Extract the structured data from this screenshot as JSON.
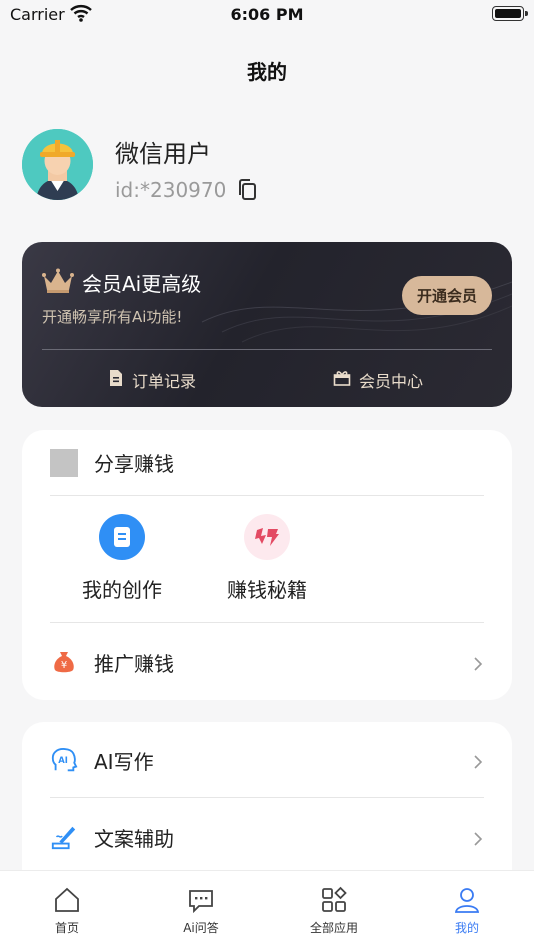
{
  "status_bar": {
    "carrier": "Carrier",
    "time": "6:06 PM"
  },
  "header": {
    "title": "我的"
  },
  "profile": {
    "name": "微信用户",
    "id": "id:*230970"
  },
  "member_card": {
    "title": "会员Ai更高级",
    "subtitle": "开通畅享所有Ai功能!",
    "button_label": "开通会员",
    "actions": [
      {
        "label": "订单记录",
        "icon": "document-icon"
      },
      {
        "label": "会员中心",
        "icon": "gift-box-icon"
      }
    ]
  },
  "share_section": {
    "title": "分享赚钱",
    "tools": [
      {
        "label": "我的创作",
        "icon": "document-icon",
        "color": "#2f8ff5"
      },
      {
        "label": "赚钱秘籍",
        "icon": "secret-book-icon",
        "color": "#e34a63"
      }
    ],
    "promote": {
      "label": "推广赚钱",
      "icon": "money-bag-icon"
    }
  },
  "ai_section": {
    "items": [
      {
        "label": "AI写作",
        "icon": "ai-head-icon"
      },
      {
        "label": "文案辅助",
        "icon": "pen-write-icon"
      }
    ]
  },
  "tab_bar": {
    "tabs": [
      {
        "label": "首页",
        "icon": "home-icon"
      },
      {
        "label": "Ai问答",
        "icon": "chat-icon"
      },
      {
        "label": "全部应用",
        "icon": "grid-apps-icon"
      },
      {
        "label": "我的",
        "icon": "user-icon"
      }
    ],
    "active_index": 3
  },
  "colors": {
    "accent": "#3a7bf3",
    "gold": "#d7b89a",
    "card_dark": "#23232c"
  }
}
